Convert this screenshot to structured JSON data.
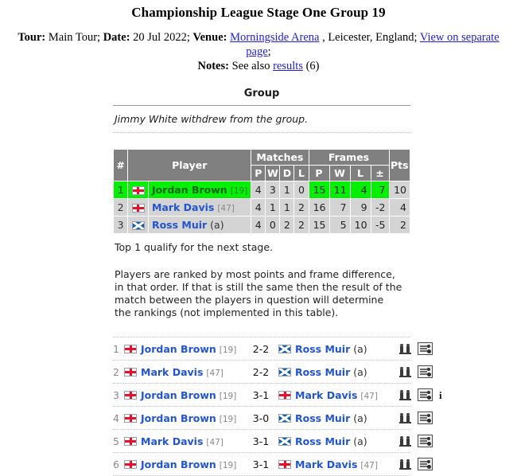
{
  "header": {
    "title": "Championship League Stage One Group 19",
    "tour_label": "Tour:",
    "tour_value": "Main Tour;",
    "date_label": "Date:",
    "date_value": "20 Jul 2022;",
    "venue_label": "Venue:",
    "venue_link": "Morningside Arena",
    "venue_rest": ", Leicester, England;",
    "separate_page_link": "View on separate page",
    "semicolon": ";",
    "notes_label": "Notes:",
    "notes_text": "See also",
    "notes_link": "results",
    "notes_count": "(6)"
  },
  "group": {
    "section_title": "Group",
    "withdrawal_note": "Jimmy White withdrew from the group.",
    "qualify_note": "Top 1 qualify for the next stage.",
    "ranking_note": "Players are ranked by most points and frame difference, in that order. If that is still the same then the result of the match between the players in question will determine the rankings (not implemented in this table)."
  },
  "standings": {
    "columns": {
      "rank": "#",
      "player": "Player",
      "matches_group": "Matches",
      "frames_group": "Frames",
      "points": "Pts",
      "m_p": "P",
      "m_w": "W",
      "m_d": "D",
      "m_l": "L",
      "f_p": "P",
      "f_w": "W",
      "f_l": "L",
      "f_diff": "±"
    },
    "rows": [
      {
        "rank": "1",
        "flag": "flag-england-icon",
        "player": "Jordan Brown",
        "world_rank": "[19]",
        "suffix": "",
        "mp": "4",
        "mw": "3",
        "md": "1",
        "ml": "0",
        "fp": "15",
        "fw": "11",
        "fl": "4",
        "fdiff": "7",
        "pts": "10",
        "highlight": "true"
      },
      {
        "rank": "2",
        "flag": "flag-england-icon",
        "player": "Mark Davis",
        "world_rank": "[47]",
        "suffix": "",
        "mp": "4",
        "mw": "1",
        "md": "1",
        "ml": "2",
        "fp": "16",
        "fw": "7",
        "fl": "9",
        "fdiff": "-2",
        "pts": "4",
        "highlight": "false"
      },
      {
        "rank": "3",
        "flag": "flag-scotland-icon",
        "player": "Ross Muir",
        "world_rank": "",
        "suffix": "(a)",
        "mp": "4",
        "mw": "0",
        "md": "2",
        "ml": "2",
        "fp": "15",
        "fw": "5",
        "fl": "10",
        "fdiff": "-5",
        "pts": "2",
        "highlight": "false"
      }
    ]
  },
  "matches": [
    {
      "no": "1",
      "home_flag": "flag-england-icon",
      "home": "Jordan Brown",
      "home_rank": "[19]",
      "home_suffix": "",
      "score": "2-2",
      "away_flag": "flag-scotland-icon",
      "away": "Ross Muir",
      "away_rank": "",
      "away_suffix": "(a)",
      "has_info": "false"
    },
    {
      "no": "2",
      "home_flag": "flag-england-icon",
      "home": "Mark Davis",
      "home_rank": "[47]",
      "home_suffix": "",
      "score": "2-2",
      "away_flag": "flag-scotland-icon",
      "away": "Ross Muir",
      "away_rank": "",
      "away_suffix": "(a)",
      "has_info": "false"
    },
    {
      "no": "3",
      "home_flag": "flag-england-icon",
      "home": "Jordan Brown",
      "home_rank": "[19]",
      "home_suffix": "",
      "score": "3-1",
      "away_flag": "flag-england-icon",
      "away": "Mark Davis",
      "away_rank": "[47]",
      "away_suffix": "",
      "has_info": "true"
    },
    {
      "no": "4",
      "home_flag": "flag-england-icon",
      "home": "Jordan Brown",
      "home_rank": "[19]",
      "home_suffix": "",
      "score": "3-0",
      "away_flag": "flag-scotland-icon",
      "away": "Ross Muir",
      "away_rank": "",
      "away_suffix": "(a)",
      "has_info": "false"
    },
    {
      "no": "5",
      "home_flag": "flag-england-icon",
      "home": "Mark Davis",
      "home_rank": "[47]",
      "home_suffix": "",
      "score": "3-1",
      "away_flag": "flag-scotland-icon",
      "away": "Ross Muir",
      "away_rank": "",
      "away_suffix": "(a)",
      "has_info": "false"
    },
    {
      "no": "6",
      "home_flag": "flag-england-icon",
      "home": "Jordan Brown",
      "home_rank": "[19]",
      "home_suffix": "",
      "score": "3-1",
      "away_flag": "flag-england-icon",
      "away": "Mark Davis",
      "away_rank": "[47]",
      "away_suffix": "",
      "has_info": "false"
    }
  ],
  "colors": {
    "highlight_green": "#00f000",
    "header_gray": "#808080",
    "cell_gray": "#d4d4d4",
    "link_blue": "#2255cc"
  }
}
